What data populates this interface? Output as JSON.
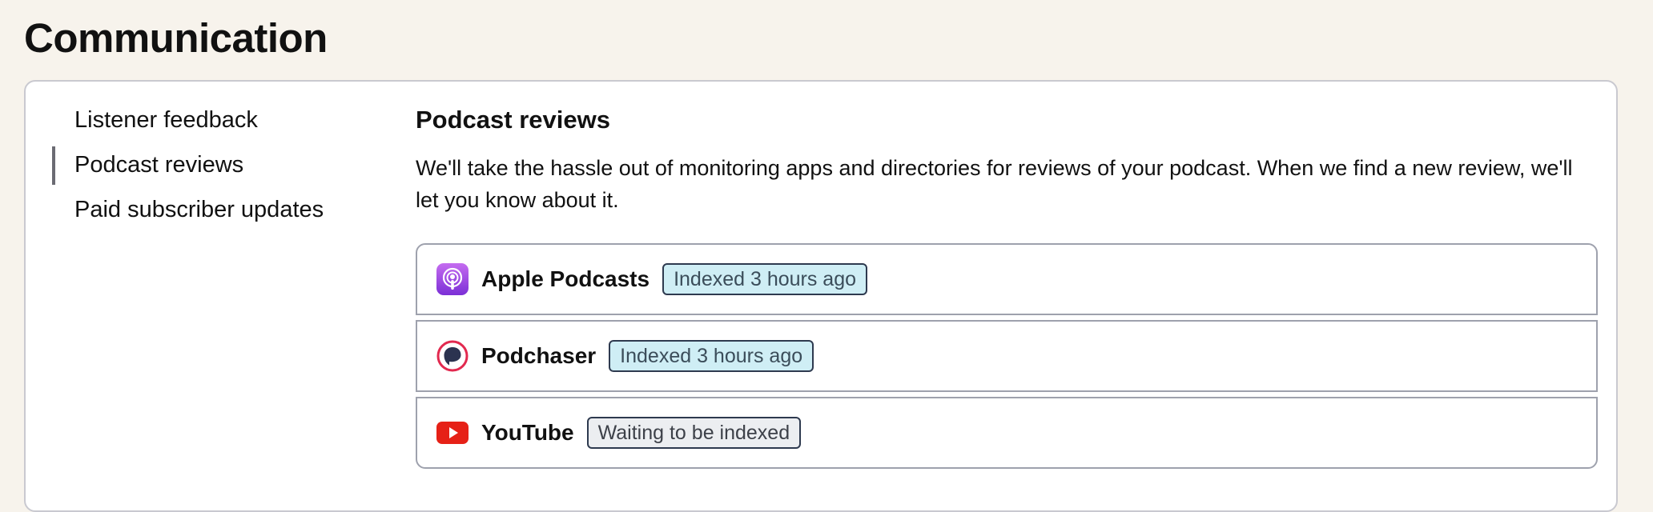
{
  "page": {
    "title": "Communication"
  },
  "nav": {
    "items": [
      {
        "label": "Listener feedback",
        "active": false
      },
      {
        "label": "Podcast reviews",
        "active": true
      },
      {
        "label": "Paid subscriber updates",
        "active": false
      }
    ]
  },
  "section": {
    "heading": "Podcast reviews",
    "description": "We'll take the hassle out of monitoring apps and directories for reviews of your podcast. When we find a new review, we'll let you know about it."
  },
  "sources": [
    {
      "name": "Apple Podcasts",
      "status": "Indexed 3 hours ago",
      "status_type": "indexed",
      "icon": "apple-podcasts-icon"
    },
    {
      "name": "Podchaser",
      "status": "Indexed 3 hours ago",
      "status_type": "indexed",
      "icon": "podchaser-icon"
    },
    {
      "name": "YouTube",
      "status": "Waiting to be indexed",
      "status_type": "waiting",
      "icon": "youtube-icon"
    }
  ],
  "colors": {
    "page_background": "#f7f3ec",
    "indexed_badge_bg": "#cfeef5",
    "waiting_badge_bg": "#eceef1",
    "apple_podcasts_purple": "#9b4de0",
    "podchaser_red": "#e2294f",
    "youtube_red": "#e62117"
  }
}
